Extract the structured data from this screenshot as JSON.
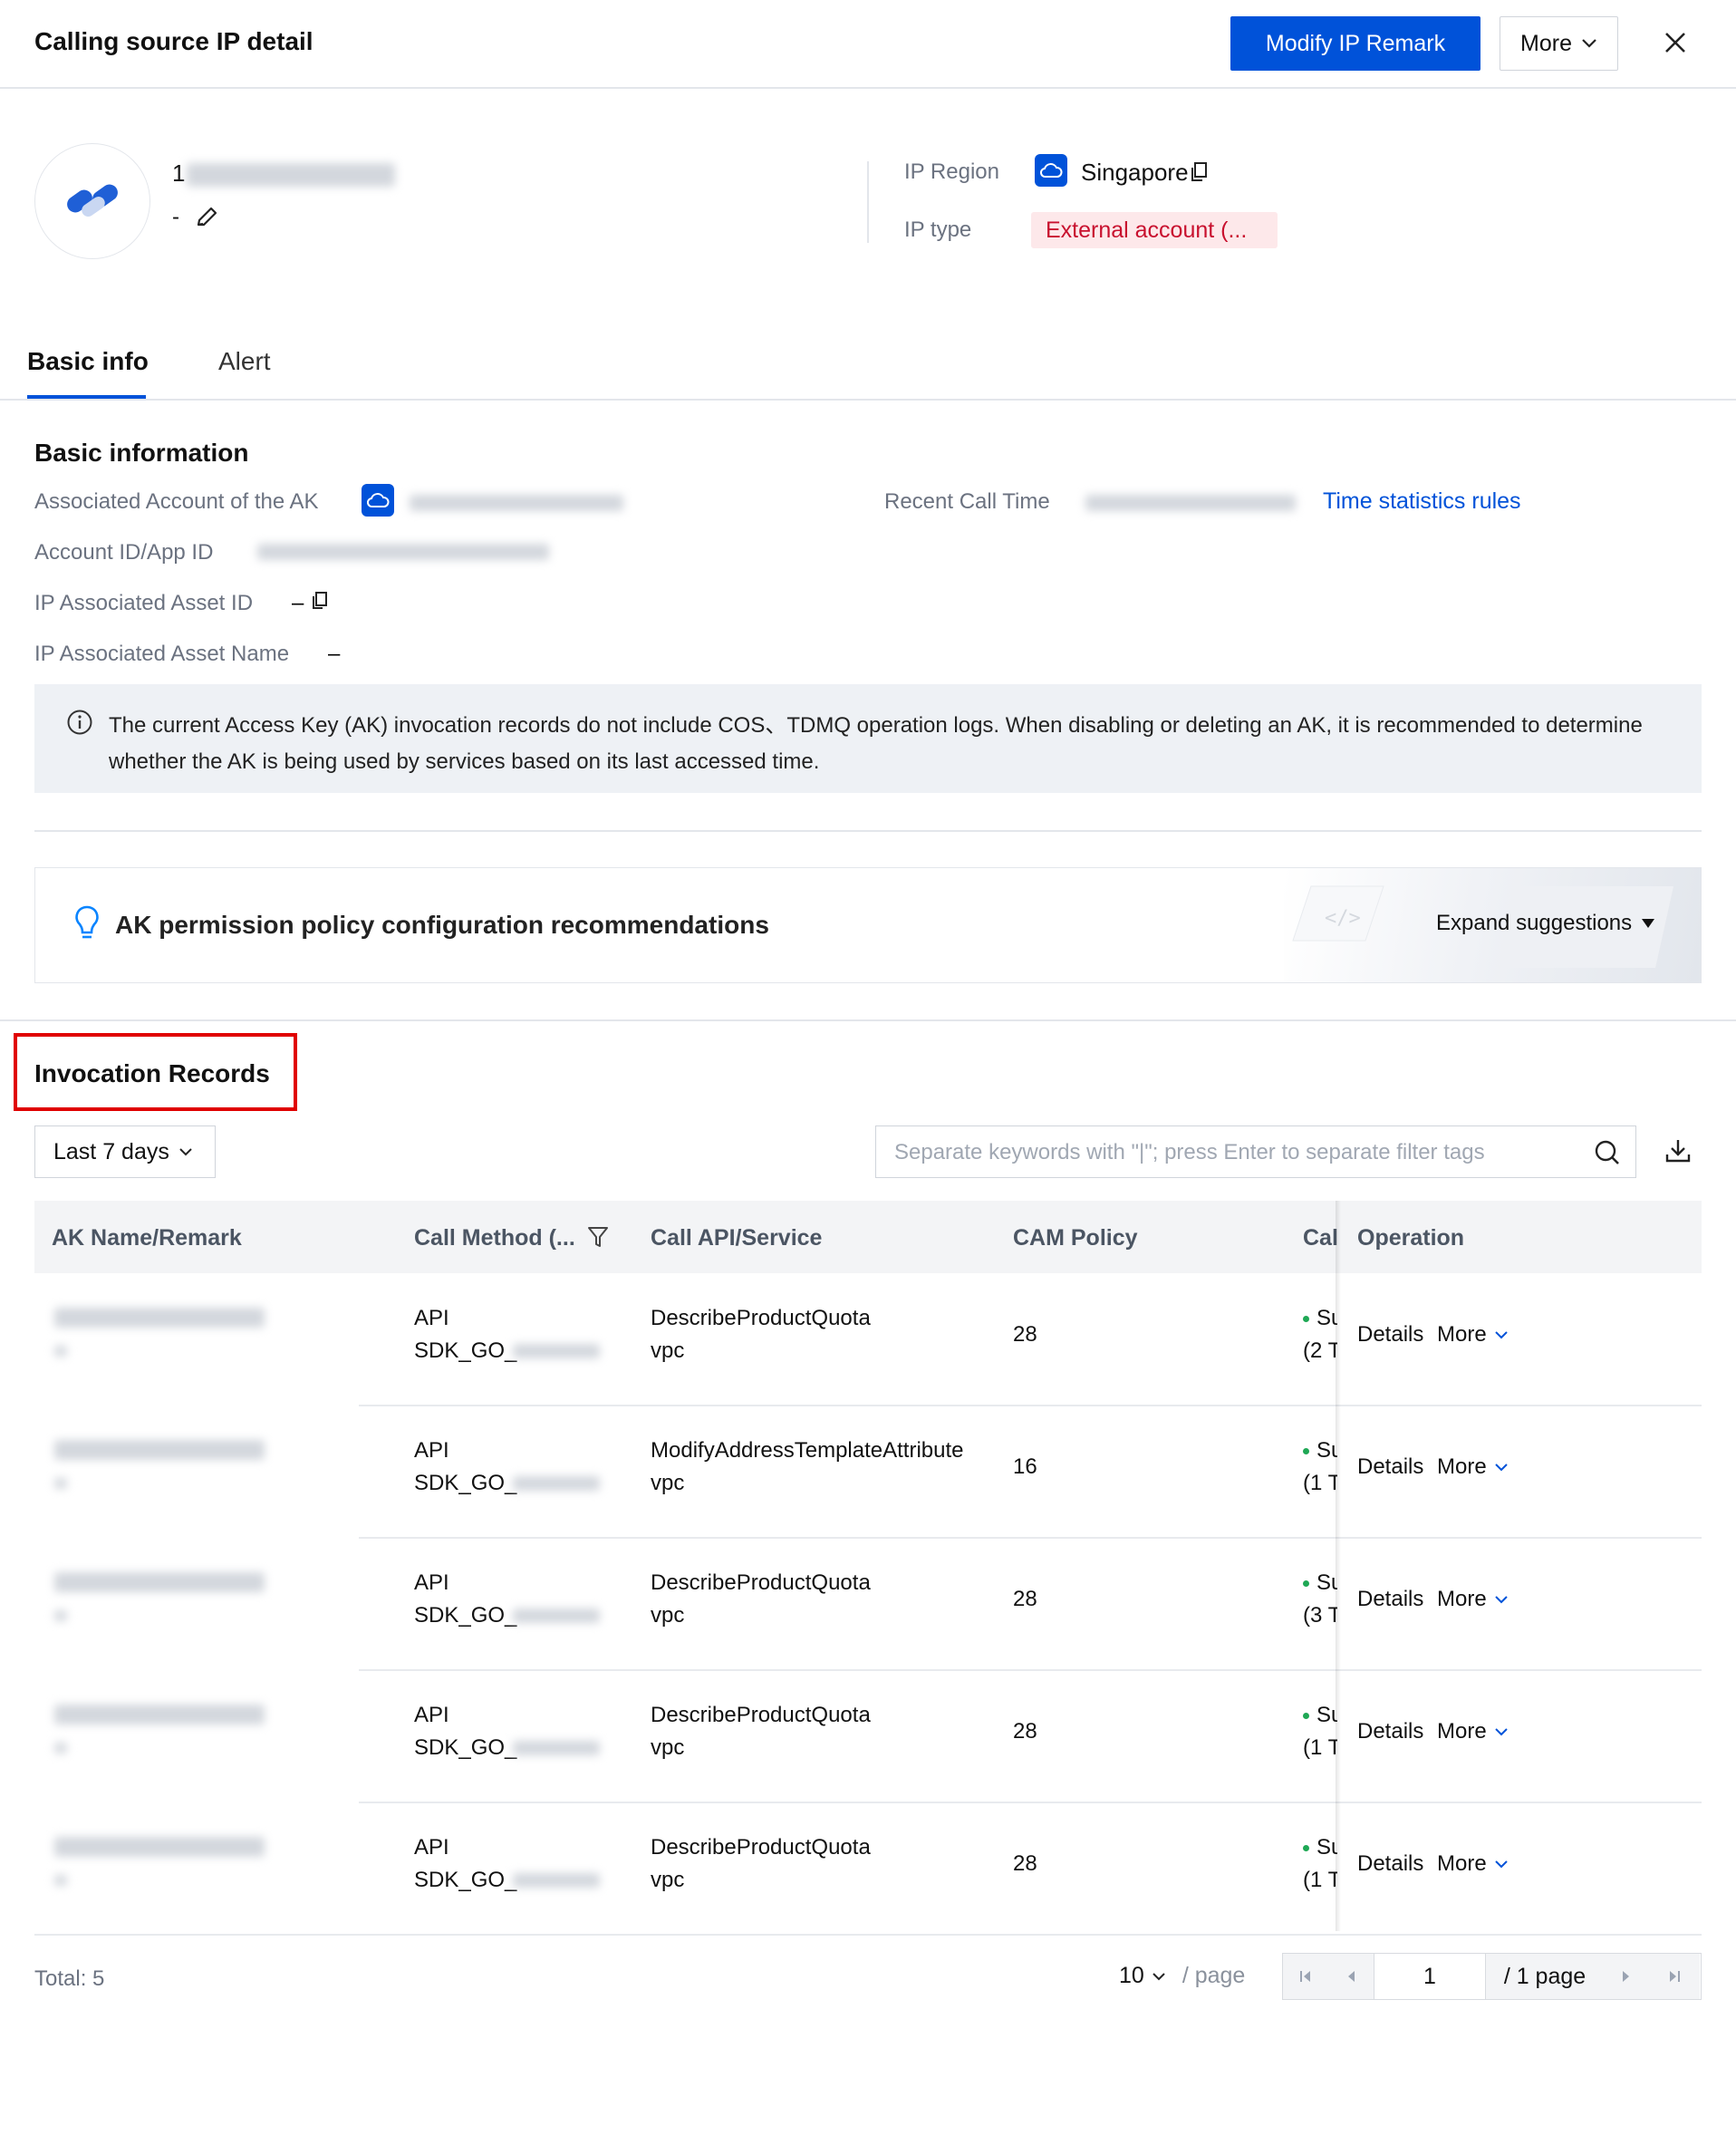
{
  "header": {
    "title": "Calling source IP detail",
    "modify_button": "Modify IP Remark",
    "more_button": "More"
  },
  "profile": {
    "ip_prefix": "1",
    "remark": "-",
    "ip_region_label": "IP Region",
    "ip_region_value": "Singapore",
    "ip_type_label": "IP type",
    "ip_type_value": "External account (..."
  },
  "tabs": [
    {
      "label": "Basic info",
      "active": true
    },
    {
      "label": "Alert",
      "active": false
    }
  ],
  "basic_info": {
    "title": "Basic information",
    "associated_account_label": "Associated Account of the AK",
    "account_id_label": "Account ID/App ID",
    "asset_id_label": "IP Associated Asset ID",
    "asset_id_value": "–",
    "asset_name_label": "IP Associated Asset Name",
    "asset_name_value": "–",
    "recent_call_label": "Recent Call Time",
    "time_rules_link": "Time statistics rules"
  },
  "notice": "The current Access Key (AK) invocation records do not include COS、TDMQ operation logs. When disabling or deleting an AK, it is recommended to determine whether the AK is being used by services based on its last accessed time.",
  "recommendation": {
    "title": "AK permission policy configuration recommendations",
    "expand": "Expand suggestions"
  },
  "records": {
    "title": "Invocation Records",
    "range": "Last 7 days",
    "search_placeholder": "Separate keywords with \"|\"; press Enter to separate filter tags",
    "columns": {
      "ak": "AK Name/Remark",
      "method": "Call Method (...",
      "api": "Call API/Service",
      "cam": "CAM Policy",
      "call": "Call",
      "operation": "Operation"
    },
    "rows": [
      {
        "method1": "API",
        "method2": "SDK_GO_",
        "api": "DescribeProductQuota",
        "service": "vpc",
        "cam": "28",
        "status": "Su",
        "count": "(2 T",
        "details": "Details",
        "more": "More"
      },
      {
        "method1": "API",
        "method2": "SDK_GO_",
        "api": "ModifyAddressTemplateAttribute",
        "service": "vpc",
        "cam": "16",
        "status": "Su",
        "count": "(1 T",
        "details": "Details",
        "more": "More"
      },
      {
        "method1": "API",
        "method2": "SDK_GO_",
        "api": "DescribeProductQuota",
        "service": "vpc",
        "cam": "28",
        "status": "Su",
        "count": "(3 T",
        "details": "Details",
        "more": "More"
      },
      {
        "method1": "API",
        "method2": "SDK_GO_",
        "api": "DescribeProductQuota",
        "service": "vpc",
        "cam": "28",
        "status": "Su",
        "count": "(1 T",
        "details": "Details",
        "more": "More"
      },
      {
        "method1": "API",
        "method2": "SDK_GO_",
        "api": "DescribeProductQuota",
        "service": "vpc",
        "cam": "28",
        "status": "Su",
        "count": "(1 T",
        "details": "Details",
        "more": "More"
      }
    ]
  },
  "footer": {
    "total": "Total: 5",
    "page_size": "10",
    "per_page": "/ page",
    "current_page": "1",
    "total_pages": "/ 1 page"
  },
  "colors": {
    "primary": "#0052d9",
    "danger": "#c8102e",
    "success": "#1fa855"
  }
}
